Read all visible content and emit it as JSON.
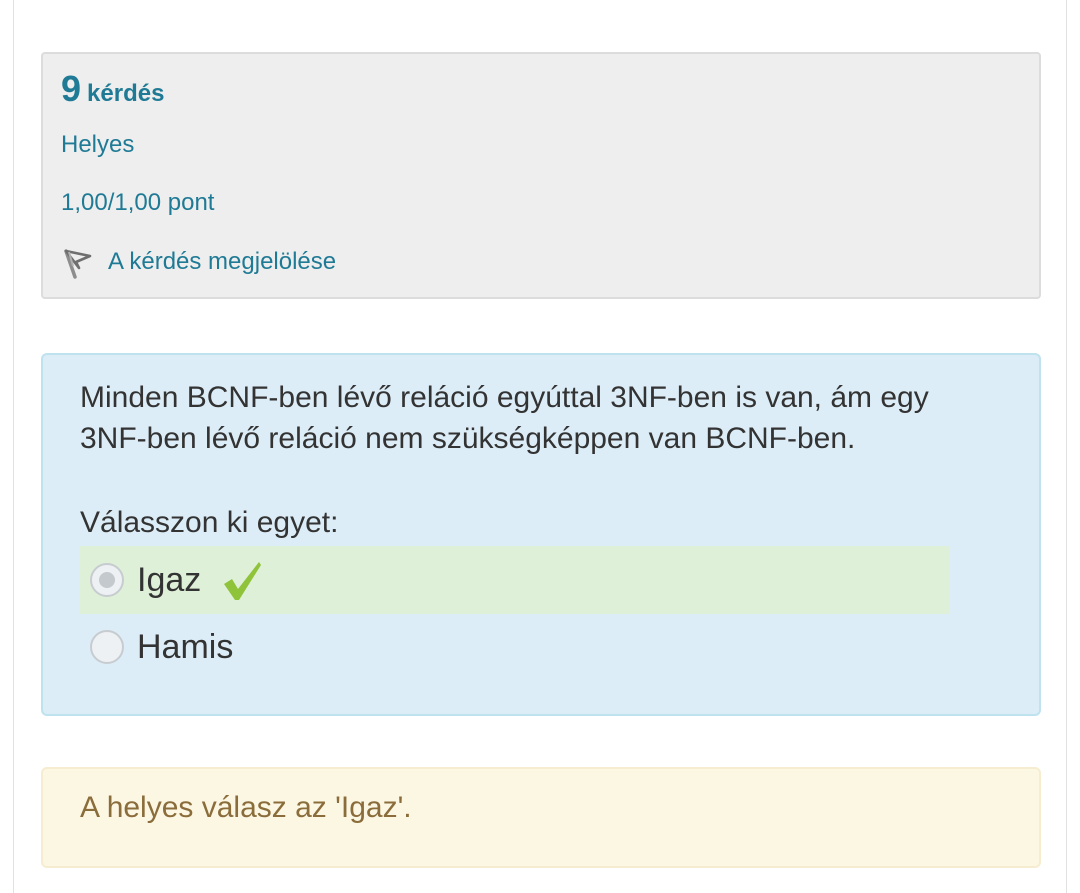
{
  "info": {
    "question_number": "9",
    "question_word": "kérdés",
    "state": "Helyes",
    "grade": "1,00/1,00 pont",
    "flag_label": "A kérdés megjelölése",
    "flag_icon": "flag-icon"
  },
  "question": {
    "text": "Minden BCNF-ben lévő reláció egyúttal 3NF-ben is van, ám egy 3NF-ben lévő reláció nem szükségképpen van BCNF-ben.",
    "prompt": "Válasszon ki egyet:",
    "answers": [
      {
        "label": "Igaz",
        "selected": true,
        "correct": true
      },
      {
        "label": "Hamis",
        "selected": false,
        "correct": false
      }
    ],
    "correct_icon": "checkmark-icon"
  },
  "feedback": {
    "right_answer": "A helyes válasz az 'Igaz'."
  },
  "colors": {
    "link": "#1f7a95",
    "question_bg": "#dcedf7",
    "correct_bg": "#dff0d8",
    "check": "#8fc33a",
    "feedback_bg": "#fcf7e3",
    "feedback_text": "#8a6d3b"
  }
}
